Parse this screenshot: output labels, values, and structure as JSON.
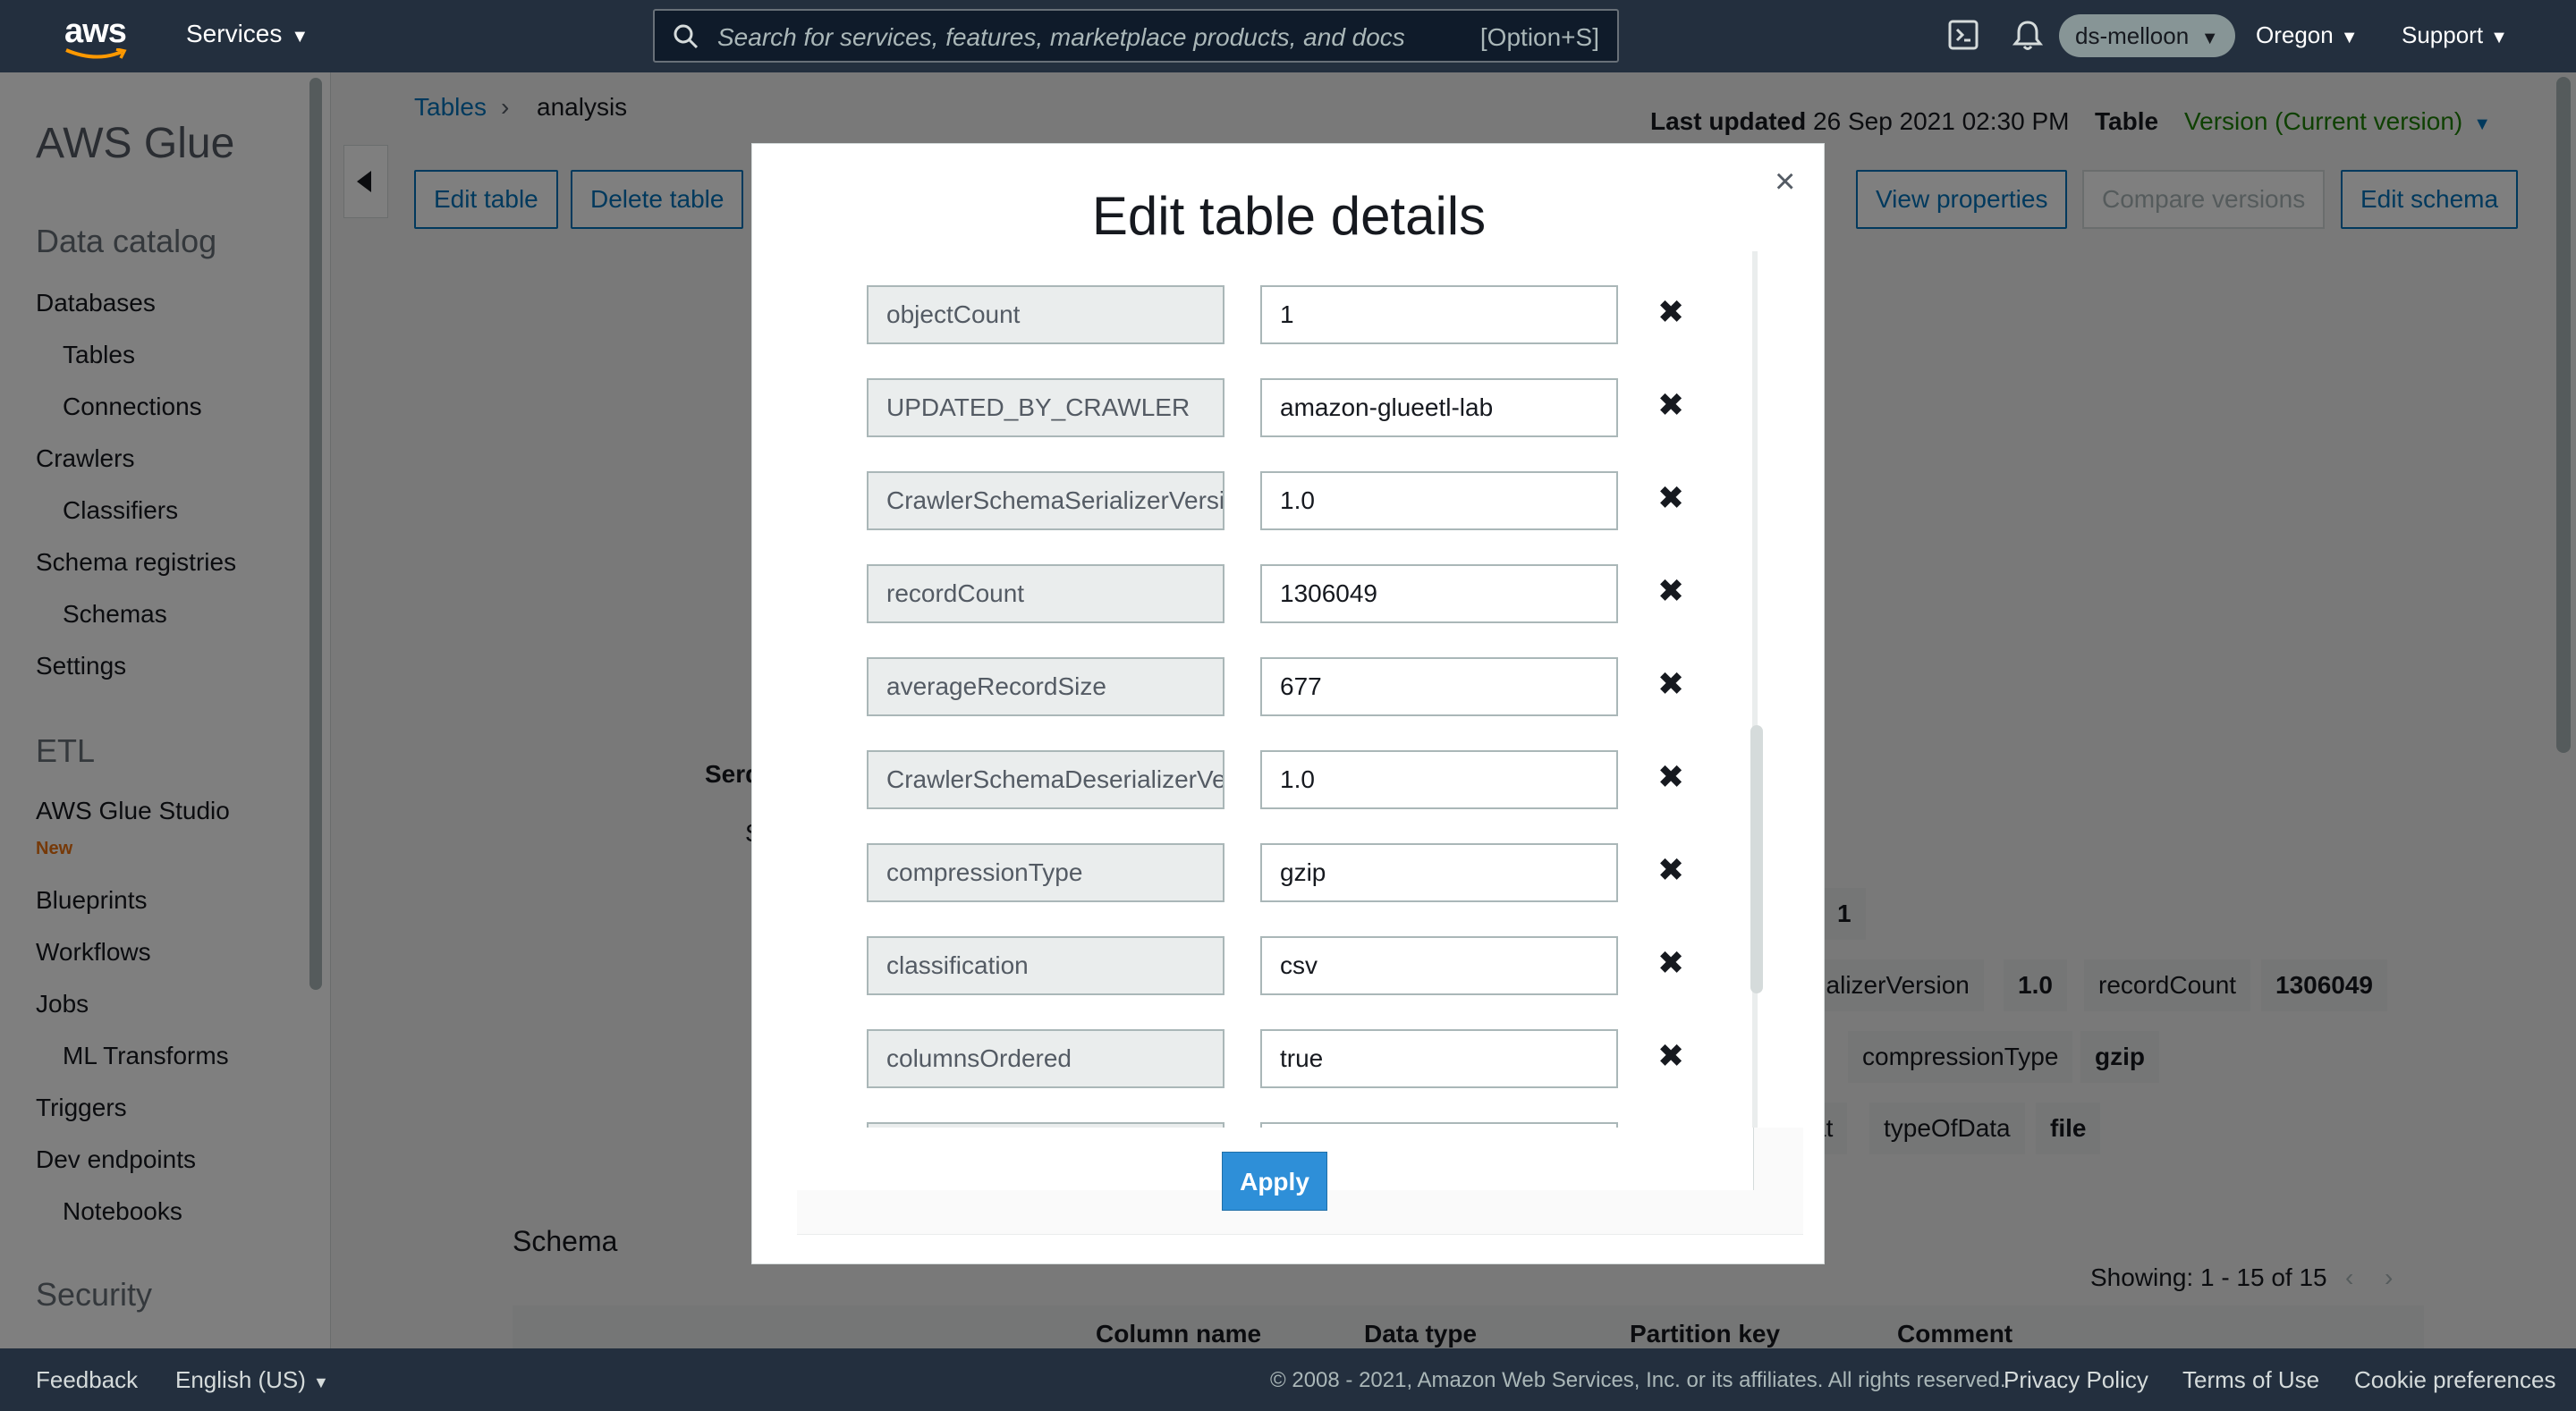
{
  "topnav": {
    "logo_text": "aws",
    "services_label": "Services",
    "search_placeholder": "Search for services, features, marketplace products, and docs",
    "search_shortcut": "[Option+S]",
    "account": "ds-melloon",
    "region": "Oregon",
    "support": "Support"
  },
  "sidebar": {
    "title": "AWS Glue",
    "sections": [
      {
        "label": "Data catalog"
      },
      {
        "label": "ETL"
      },
      {
        "label": "Security"
      }
    ],
    "items": [
      {
        "label": "Databases"
      },
      {
        "label": "Tables"
      },
      {
        "label": "Connections"
      },
      {
        "label": "Crawlers"
      },
      {
        "label": "Classifiers"
      },
      {
        "label": "Schema registries"
      },
      {
        "label": "Schemas"
      },
      {
        "label": "Settings"
      },
      {
        "label": "AWS Glue Studio"
      },
      {
        "label": "Blueprints"
      },
      {
        "label": "Workflows"
      },
      {
        "label": "Jobs"
      },
      {
        "label": "ML Transforms"
      },
      {
        "label": "Triggers"
      },
      {
        "label": "Dev endpoints"
      },
      {
        "label": "Notebooks"
      }
    ],
    "new_badge": "New"
  },
  "main": {
    "breadcrumb": {
      "parent": "Tables",
      "sep": "›",
      "current": "analysis"
    },
    "last_updated_label": "Last updated",
    "last_updated_value": "26 Sep 2021 02:30 PM",
    "table_label": "Table",
    "version": "Version (Current version)",
    "buttons": {
      "edit_table": "Edit table",
      "delete_table": "Delete table",
      "view_properties": "View properties",
      "compare_versions": "Compare versions",
      "edit_schema": "Edit schema"
    },
    "partial_texts": {
      "serde": "Serd",
      "s": "S"
    },
    "props": [
      {
        "text": "1"
      },
      {
        "text": "rializerVersion"
      },
      {
        "text": "1.0"
      },
      {
        "text": "recordCount"
      },
      {
        "text": "1306049"
      },
      {
        "text": "compressionType"
      },
      {
        "text": "gzip"
      },
      {
        "text": "at"
      },
      {
        "text": "typeOfData"
      },
      {
        "text": "file"
      }
    ],
    "schema_title": "Schema",
    "showing": "Showing: 1 - 15 of 15",
    "columns": [
      "Column name",
      "Data type",
      "Partition key",
      "Comment"
    ]
  },
  "modal": {
    "title": "Edit table details",
    "close": "×",
    "delete_icon": "✖",
    "rows": [
      {
        "key": "objectCount",
        "value": "1"
      },
      {
        "key": "UPDATED_BY_CRAWLER",
        "value": "amazon-glueetl-lab"
      },
      {
        "key": "CrawlerSchemaSerializerVersion",
        "value": "1.0"
      },
      {
        "key": "recordCount",
        "value": "1306049"
      },
      {
        "key": "averageRecordSize",
        "value": "677"
      },
      {
        "key": "CrawlerSchemaDeserializerVersion",
        "value": "1.0"
      },
      {
        "key": "compressionType",
        "value": "gzip"
      },
      {
        "key": "classification",
        "value": "csv"
      },
      {
        "key": "columnsOrdered",
        "value": "true"
      }
    ],
    "apply_label": "Apply"
  },
  "footer": {
    "feedback": "Feedback",
    "language": "English (US)",
    "copyright": "© 2008 - 2021, Amazon Web Services, Inc. or its affiliates. All rights reserved.",
    "privacy": "Privacy Policy",
    "terms": "Terms of Use",
    "cookies": "Cookie preferences"
  }
}
